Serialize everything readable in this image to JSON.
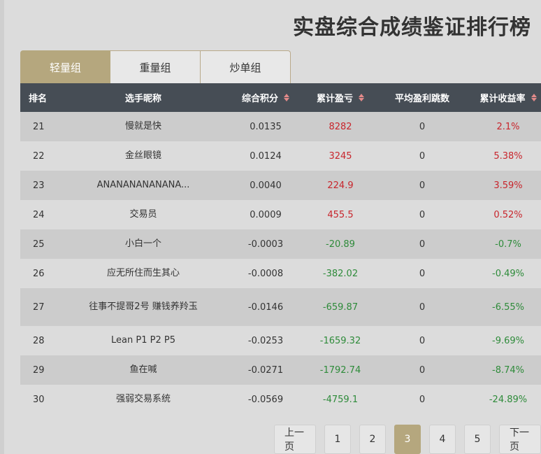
{
  "page": {
    "title": "实盘综合成绩鉴证排行榜"
  },
  "tabs": [
    {
      "label": "轻量组",
      "active": true
    },
    {
      "label": "重量组",
      "active": false
    },
    {
      "label": "炒单组",
      "active": false
    }
  ],
  "table": {
    "headers": {
      "rank": "排名",
      "name": "选手昵称",
      "score": "综合积分",
      "pnl": "累计盈亏",
      "ticks": "平均盈利跳数",
      "yield": "累计收益率"
    },
    "rows": [
      {
        "rank": "21",
        "name": "慢就是快",
        "score": "0.0135",
        "pnl": "8282",
        "ticks": "0",
        "yield": "2.1%",
        "sign": "pos"
      },
      {
        "rank": "22",
        "name": "金丝眼镜",
        "score": "0.0124",
        "pnl": "3245",
        "ticks": "0",
        "yield": "5.38%",
        "sign": "pos"
      },
      {
        "rank": "23",
        "name": "ANANANANANANA...",
        "score": "0.0040",
        "pnl": "224.9",
        "ticks": "0",
        "yield": "3.59%",
        "sign": "pos"
      },
      {
        "rank": "24",
        "name": "交易员",
        "score": "0.0009",
        "pnl": "455.5",
        "ticks": "0",
        "yield": "0.52%",
        "sign": "pos"
      },
      {
        "rank": "25",
        "name": "小白一个",
        "score": "-0.0003",
        "pnl": "-20.89",
        "ticks": "0",
        "yield": "-0.7%",
        "sign": "neg"
      },
      {
        "rank": "26",
        "name": "应无所住而生其心",
        "score": "-0.0008",
        "pnl": "-382.02",
        "ticks": "0",
        "yield": "-0.49%",
        "sign": "neg"
      },
      {
        "rank": "27",
        "name": "往事不提哥2号 赚钱养羚玉",
        "score": "-0.0146",
        "pnl": "-659.87",
        "ticks": "0",
        "yield": "-6.55%",
        "sign": "neg"
      },
      {
        "rank": "28",
        "name": "Lean  P1  P2  P5",
        "score": "-0.0253",
        "pnl": "-1659.32",
        "ticks": "0",
        "yield": "-9.69%",
        "sign": "neg"
      },
      {
        "rank": "29",
        "name": "鱼在喊",
        "score": "-0.0271",
        "pnl": "-1792.74",
        "ticks": "0",
        "yield": "-8.74%",
        "sign": "neg"
      },
      {
        "rank": "30",
        "name": "强弱交易系统",
        "score": "-0.0569",
        "pnl": "-4759.1",
        "ticks": "0",
        "yield": "-24.89%",
        "sign": "neg"
      }
    ]
  },
  "pager": {
    "prev": "上一页",
    "pages": [
      "1",
      "2",
      "3",
      "4",
      "5"
    ],
    "current": "3",
    "next": "下一页"
  },
  "colors": {
    "accent": "#b5a77e",
    "header_bg": "#464d55",
    "positive": "#c8252c",
    "negative": "#2e8b3a"
  }
}
